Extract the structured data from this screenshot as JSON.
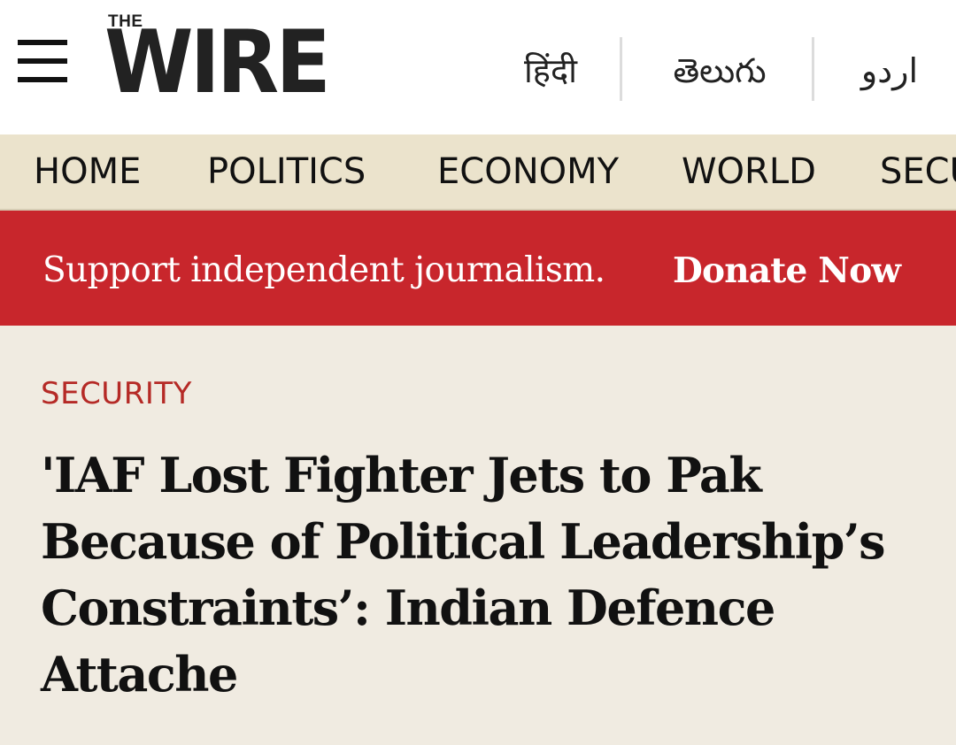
{
  "header": {
    "logo_small": "THE",
    "logo_main": "WIRE",
    "languages": [
      "हिंदी",
      "తెలుగు",
      "اردو"
    ]
  },
  "nav": {
    "items": [
      "HOME",
      "POLITICS",
      "ECONOMY",
      "WORLD",
      "SECU"
    ]
  },
  "banner": {
    "text": "Support independent journalism.",
    "link": "Donate Now",
    "color": "#c8262c"
  },
  "article": {
    "category": "SECURITY",
    "headline": "'IAF Lost Fighter Jets to Pak Because of Political Leadership’s Constraints’: Indian Defence Attache"
  },
  "colors": {
    "page_bg": "#f0ebe1",
    "nav_bg": "#ebe3cc",
    "category": "#b52a26"
  },
  "icons": {
    "menu": "hamburger-menu-icon"
  }
}
